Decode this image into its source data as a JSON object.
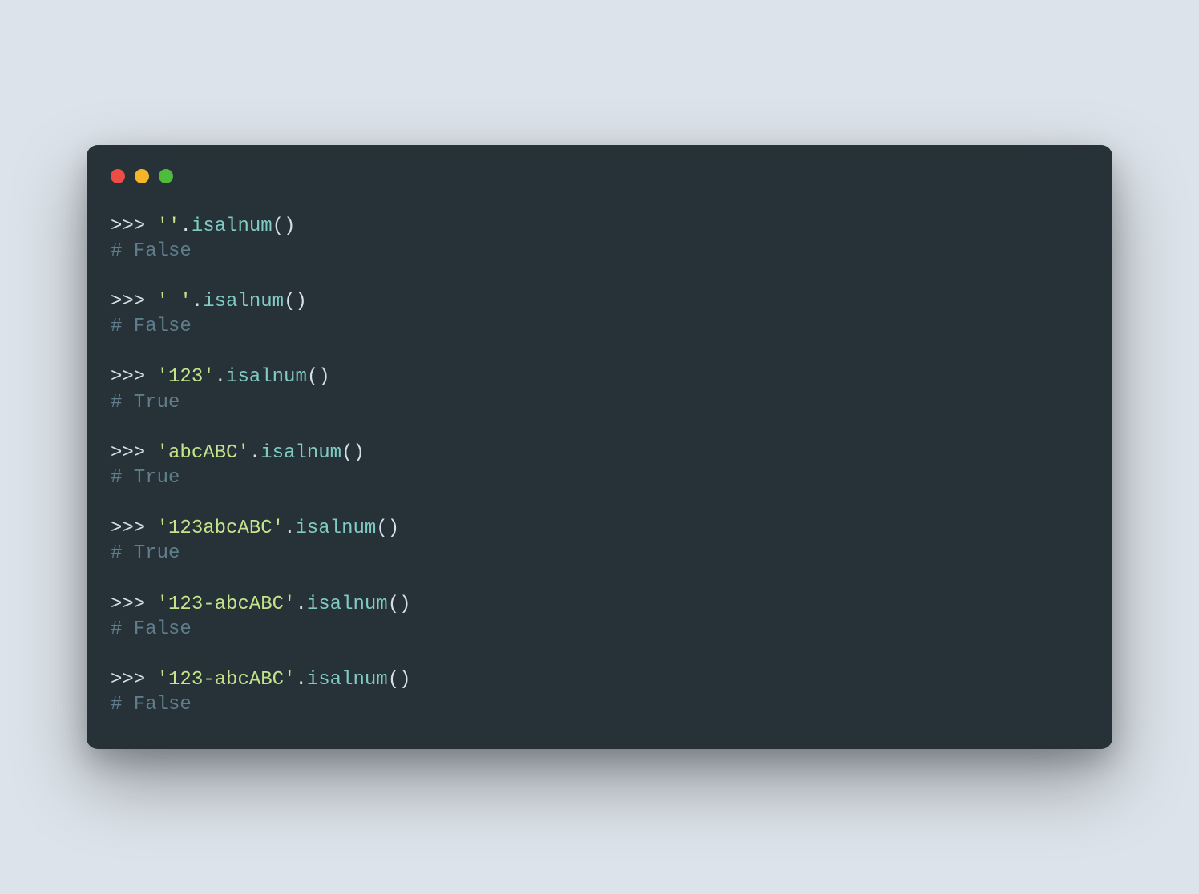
{
  "colors": {
    "background": "#dce3ea",
    "terminal_bg": "#263238",
    "close": "#ec4d47",
    "minimize": "#f5b429",
    "zoom": "#4fbb3a",
    "prompt": "#d8dee9",
    "string": "#c3e48a",
    "method": "#80cbc4",
    "comment": "#607d8b"
  },
  "blocks": [
    {
      "prompt": ">>>",
      "string": "''",
      "dot": ".",
      "method": "isalnum",
      "parens": "()",
      "comment": "# False"
    },
    {
      "prompt": ">>>",
      "string": "' '",
      "dot": ".",
      "method": "isalnum",
      "parens": "()",
      "comment": "# False"
    },
    {
      "prompt": ">>>",
      "string": "'123'",
      "dot": ".",
      "method": "isalnum",
      "parens": "()",
      "comment": "# True"
    },
    {
      "prompt": ">>>",
      "string": "'abcABC'",
      "dot": ".",
      "method": "isalnum",
      "parens": "()",
      "comment": "# True"
    },
    {
      "prompt": ">>>",
      "string": "'123abcABC'",
      "dot": ".",
      "method": "isalnum",
      "parens": "()",
      "comment": "# True"
    },
    {
      "prompt": ">>>",
      "string": "'123-abcABC'",
      "dot": ".",
      "method": "isalnum",
      "parens": "()",
      "comment": "# False"
    },
    {
      "prompt": ">>>",
      "string": "'123-abcABC'",
      "dot": ".",
      "method": "isalnum",
      "parens": "()",
      "comment": "# False"
    }
  ]
}
